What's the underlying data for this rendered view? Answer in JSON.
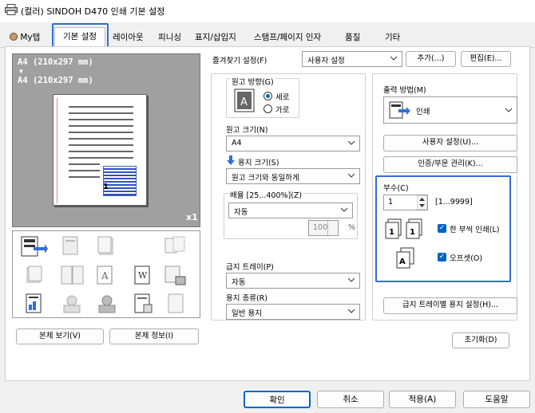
{
  "window": {
    "title": "(컬러) SINDOH D470 인쇄 기본 설정"
  },
  "tabs": [
    {
      "label": "My탭"
    },
    {
      "label": "기본 설정"
    },
    {
      "label": "레이아웃"
    },
    {
      "label": "피니싱"
    },
    {
      "label": "표지/삽입지"
    },
    {
      "label": "스탬프/페이지 인자"
    },
    {
      "label": "품질"
    },
    {
      "label": "기타"
    }
  ],
  "preview": {
    "line1": "A4 (210x297 mm)",
    "arrow": "▼",
    "line2": "A4 (210x297 mm)",
    "count": "x1",
    "page_number": "1"
  },
  "left_buttons": {
    "view": "본체 보기(V)",
    "info": "본체 정보(I)"
  },
  "favorites": {
    "label": "즐겨찾기 설정(F)",
    "value": "사용자 설정",
    "add": "추가(...)",
    "edit": "편집(E)..."
  },
  "orientation": {
    "label": "원고 방향(G)",
    "portrait": "세로",
    "landscape": "가로",
    "selected": "세로"
  },
  "original_size": {
    "label": "원고 크기(N)",
    "value": "A4"
  },
  "paper_size": {
    "label": "용지 크기(S)",
    "value": "원고 크기와 동일하게"
  },
  "zoom": {
    "label": "배율 [25...400%](Z)",
    "mode": "자동",
    "value": "100",
    "unit": "%"
  },
  "paper_tray": {
    "label": "급지 트레이(P)",
    "value": "자동"
  },
  "paper_type": {
    "label": "용지 종류(R)",
    "value": "일반 용지"
  },
  "output": {
    "label": "출력 방법(M)",
    "value": "인쇄",
    "user_settings": "사용자 설정(U)...",
    "auth": "인증/부문 관리(K)..."
  },
  "copies": {
    "label": "부수(C)",
    "value": "1",
    "range": "[1...9999]",
    "collate": "한 부씩 인쇄(L)",
    "collate_checked": true,
    "offset": "오프셋(O)",
    "offset_checked": true
  },
  "tray_settings": "급지 트레이별 용지 설정(H)...",
  "reset": "초기화(D)",
  "footer": {
    "ok": "확인",
    "cancel": "취소",
    "apply": "적용(A)",
    "help": "도움말"
  },
  "colors": {
    "accent": "#0063c9",
    "highlight": "#2f6fd8"
  }
}
